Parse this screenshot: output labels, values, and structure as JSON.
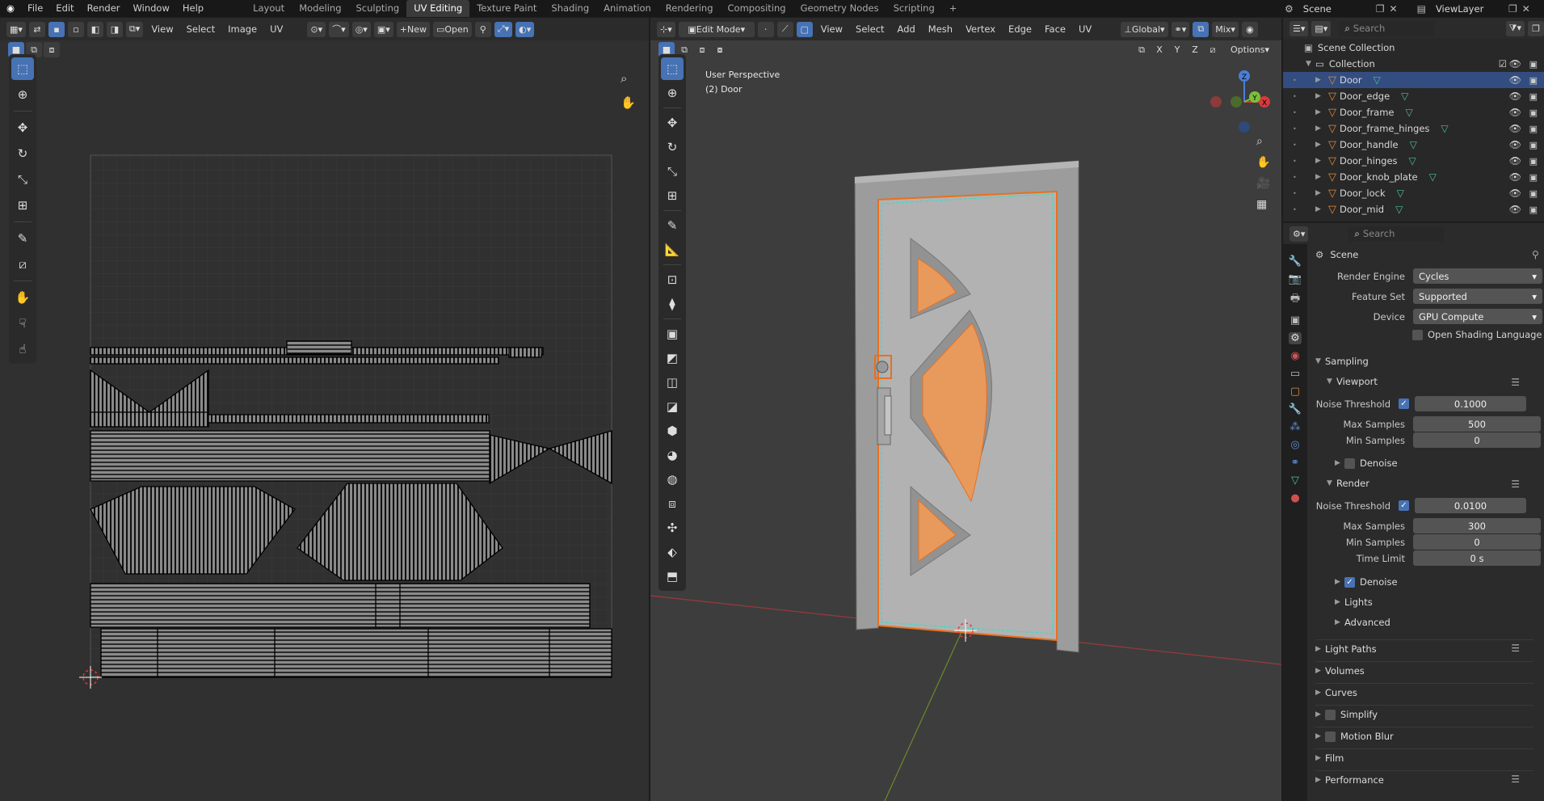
{
  "topbar": {
    "menus": [
      "File",
      "Edit",
      "Render",
      "Window",
      "Help"
    ],
    "workspaces": [
      "Layout",
      "Modeling",
      "Sculpting",
      "UV Editing",
      "Texture Paint",
      "Shading",
      "Animation",
      "Rendering",
      "Compositing",
      "Geometry Nodes",
      "Scripting"
    ],
    "active_workspace": "UV Editing",
    "add_tab": "+",
    "scene_label": "Scene",
    "viewlayer_label": "ViewLayer"
  },
  "uv_editor": {
    "menus": [
      "View",
      "Select",
      "Image",
      "UV"
    ],
    "new_label": "New",
    "open_label": "Open"
  },
  "viewport": {
    "mode": "Edit Mode",
    "menus": [
      "View",
      "Select",
      "Add",
      "Mesh",
      "Vertex",
      "Edge",
      "Face",
      "UV"
    ],
    "orientation": "Global",
    "shading_mix": "Mix",
    "options_label": "Options",
    "axis_x": "X",
    "axis_y": "Y",
    "axis_z": "Z",
    "perspective_label": "User Perspective",
    "object_label": "(2) Door"
  },
  "outliner": {
    "search_placeholder": "Search",
    "scene_collection": "Scene Collection",
    "collection": "Collection",
    "items": [
      "Door",
      "Door_edge",
      "Door_frame",
      "Door_frame_hinges",
      "Door_handle",
      "Door_hinges",
      "Door_knob_plate",
      "Door_lock",
      "Door_mid"
    ],
    "selected": "Door"
  },
  "properties": {
    "search_placeholder": "Search",
    "context": "Scene",
    "render_engine_label": "Render Engine",
    "render_engine": "Cycles",
    "feature_set_label": "Feature Set",
    "feature_set": "Supported",
    "device_label": "Device",
    "device": "GPU Compute",
    "osl_label": "Open Shading Language",
    "sampling": "Sampling",
    "viewport_sub": "Viewport",
    "render_sub": "Render",
    "noise_threshold_label": "Noise Threshold",
    "viewport_noise": "0.1000",
    "render_noise": "0.0100",
    "max_samples_label": "Max Samples",
    "min_samples_label": "Min Samples",
    "viewport_max": "500",
    "viewport_min": "0",
    "render_max": "300",
    "render_min": "0",
    "time_limit_label": "Time Limit",
    "time_limit": "0 s",
    "denoise_label": "Denoise",
    "lights": "Lights",
    "advanced": "Advanced",
    "panels": [
      "Light Paths",
      "Volumes",
      "Curves",
      "Simplify",
      "Motion Blur",
      "Film",
      "Performance"
    ]
  }
}
